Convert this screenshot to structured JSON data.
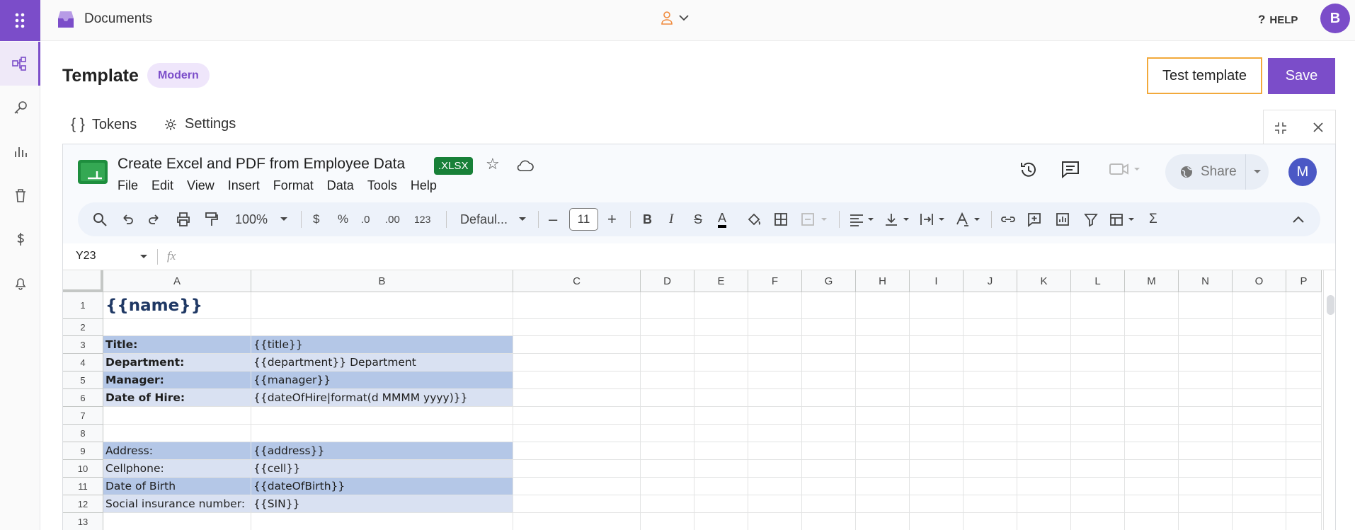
{
  "app": {
    "title": "Documents",
    "help": "HELP",
    "user_initial": "B"
  },
  "rail": {
    "items": [
      "templates",
      "keys",
      "analytics",
      "trash",
      "billing",
      "notifications"
    ]
  },
  "page": {
    "title": "Template",
    "badge": "Modern",
    "test_button": "Test template",
    "save_button": "Save"
  },
  "tabs": [
    {
      "label": "Tokens"
    },
    {
      "label": "Settings"
    }
  ],
  "sheet": {
    "title": "Create Excel and PDF from Employee Data",
    "format_badge": ".XLSX",
    "menus": [
      "File",
      "Edit",
      "View",
      "Insert",
      "Format",
      "Data",
      "Tools",
      "Help"
    ],
    "share": "Share",
    "user_initial": "M",
    "toolbar": {
      "zoom": "100%",
      "currency": "$",
      "percent": "%",
      "dec_less": ".0",
      "dec_more": ".00",
      "number_format": "123",
      "font": "Defaul...",
      "font_size": "11"
    },
    "name_box": "Y23",
    "fx": "fx",
    "columns": [
      "A",
      "B",
      "C",
      "D",
      "E",
      "F",
      "G",
      "H",
      "I",
      "J",
      "K",
      "L",
      "M",
      "N",
      "O",
      "P"
    ],
    "rows": [
      "1",
      "2",
      "3",
      "4",
      "5",
      "6",
      "7",
      "8",
      "9",
      "10",
      "11",
      "12",
      "13"
    ],
    "cells": {
      "A1": "{{name}}",
      "A3": "Title:",
      "B3": "{{title}}",
      "A4": "Department:",
      "B4": "{{department}} Department",
      "A5": "Manager:",
      "B5": "{{manager}}",
      "A6": "Date of Hire:",
      "B6": "{{dateOfHire|format(d MMMM yyyy)}}",
      "A9": "Address:",
      "B9": "{{address}}",
      "A10": "Cellphone:",
      "B10": "{{cell}}",
      "A11": "Date of Birth",
      "B11": "{{dateOfBirth}}",
      "A12": "Social insurance number:",
      "B12": "{{SIN}}"
    }
  },
  "colors": {
    "accent": "#7b4dc9",
    "highlight": "#f2a93b",
    "row_dark": "#b4c7e7",
    "row_light": "#d9e1f2",
    "name_text": "#1f3864"
  }
}
